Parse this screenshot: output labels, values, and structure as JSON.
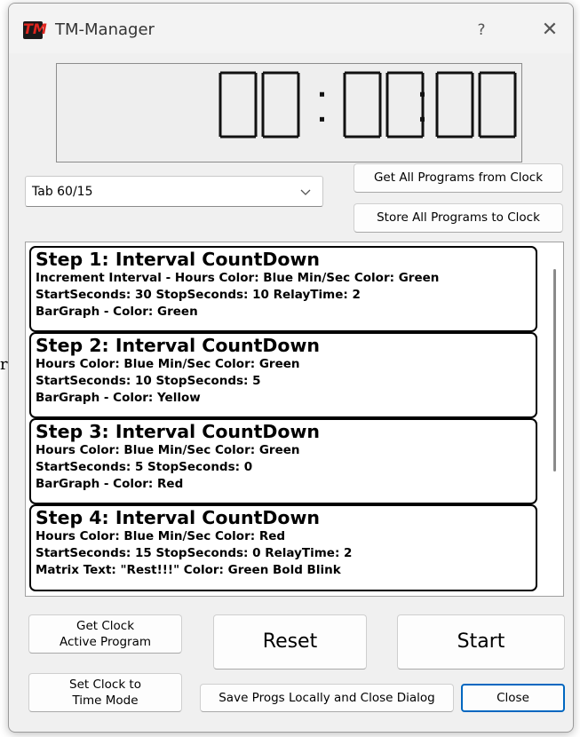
{
  "stray_text": "r",
  "window": {
    "title": "TM-Manager",
    "icon_letters": "TM",
    "help_label": "?",
    "close_label": "✕"
  },
  "clock": {
    "display": "00:00:00",
    "segment_color": "#111111",
    "background_color": "#eeeeee"
  },
  "program_select": {
    "value": "Tab 60/15"
  },
  "buttons": {
    "get_all": "Get All Programs from Clock",
    "store_all": "Store All Programs to Clock",
    "get_active_line1": "Get Clock",
    "get_active_line2": "Active Program",
    "reset": "Reset",
    "start": "Start",
    "set_time_line1": "Set Clock to",
    "set_time_line2": "Time Mode",
    "save_close": "Save Progs Locally and Close Dialog",
    "close": "Close"
  },
  "steps": [
    {
      "title": "Step 1: Interval CountDown",
      "lines": [
        "Increment Interval - Hours Color: Blue  Min/Sec Color: Green",
        "StartSeconds: 30  StopSeconds: 10 RelayTime: 2",
        "BarGraph - Color: Green"
      ]
    },
    {
      "title": "Step 2: Interval CountDown",
      "lines": [
        "Hours Color: Blue  Min/Sec Color: Green",
        "StartSeconds: 10  StopSeconds: 5",
        "BarGraph - Color: Yellow"
      ]
    },
    {
      "title": "Step 3: Interval CountDown",
      "lines": [
        "Hours Color: Blue  Min/Sec Color: Green",
        "StartSeconds: 5  StopSeconds: 0",
        "BarGraph - Color: Red"
      ]
    },
    {
      "title": "Step 4: Interval CountDown",
      "lines": [
        "Hours Color: Blue  Min/Sec Color: Red",
        "StartSeconds: 15  StopSeconds: 0 RelayTime: 2",
        "Matrix Text: \"Rest!!!\" Color: Green Bold Blink"
      ]
    }
  ],
  "colors": {
    "focus_border": "#0067c0",
    "window_bg": "#f0f0f0",
    "icon_red": "#e0261f"
  }
}
